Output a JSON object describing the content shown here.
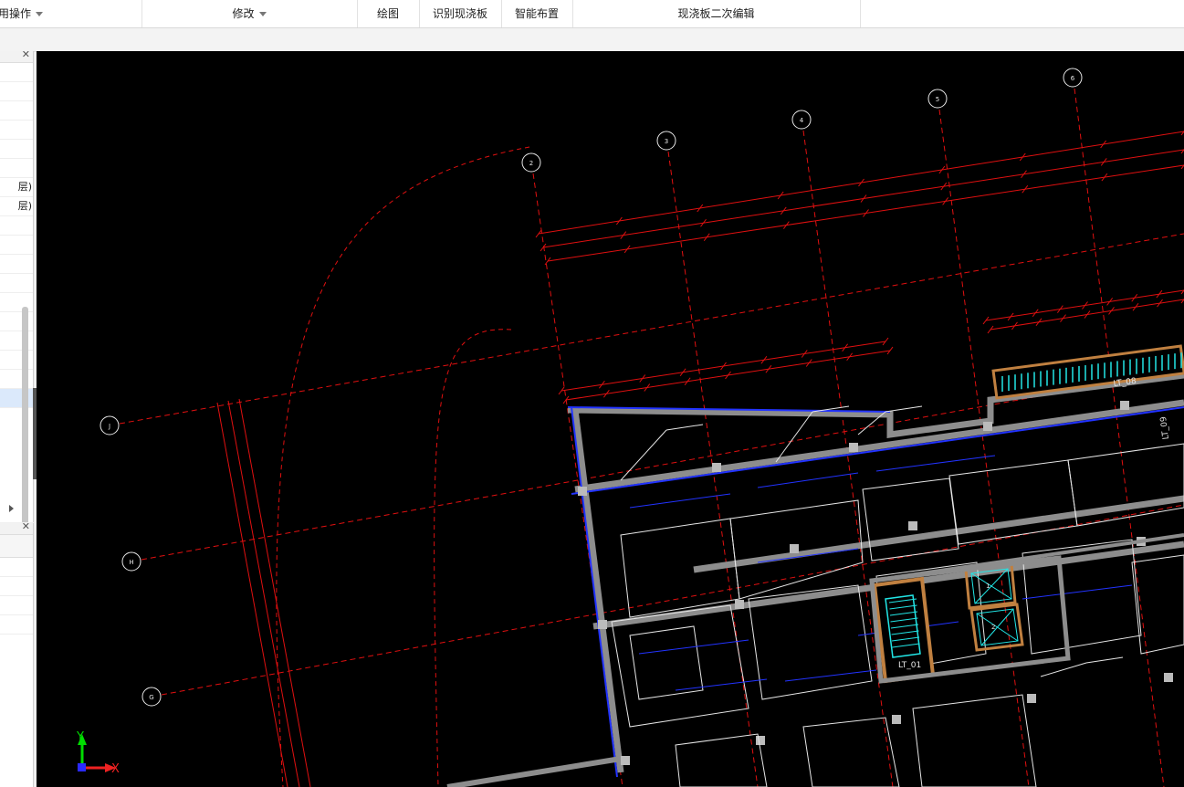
{
  "ribbon": {
    "groups": [
      {
        "label": "用操作",
        "caret": true
      },
      {
        "label": "修改",
        "caret": true
      },
      {
        "label": "绘图",
        "caret": false
      },
      {
        "label": "识别现浇板",
        "caret": false
      },
      {
        "label": "智能布置",
        "caret": false
      },
      {
        "label": "现浇板二次编辑",
        "caret": false
      }
    ]
  },
  "left_panel": {
    "close_glyph": "✕",
    "rows": [
      "",
      "",
      "",
      "",
      "",
      "",
      "层)",
      "层)",
      "",
      "",
      "",
      "",
      "",
      "",
      "",
      "",
      "",
      ""
    ],
    "lower_close_glyph": "✕"
  },
  "canvas": {
    "background": "#000000",
    "grid_bubbles_top": [
      "2",
      "3",
      "4",
      "5",
      "6"
    ],
    "grid_bubbles_left": [
      "J",
      "H",
      "G"
    ],
    "rooms": [
      "LT_08",
      "LT_09",
      "LT_01",
      "1",
      "2"
    ],
    "ucs": {
      "y_label": "Y",
      "x_label": "X"
    }
  }
}
